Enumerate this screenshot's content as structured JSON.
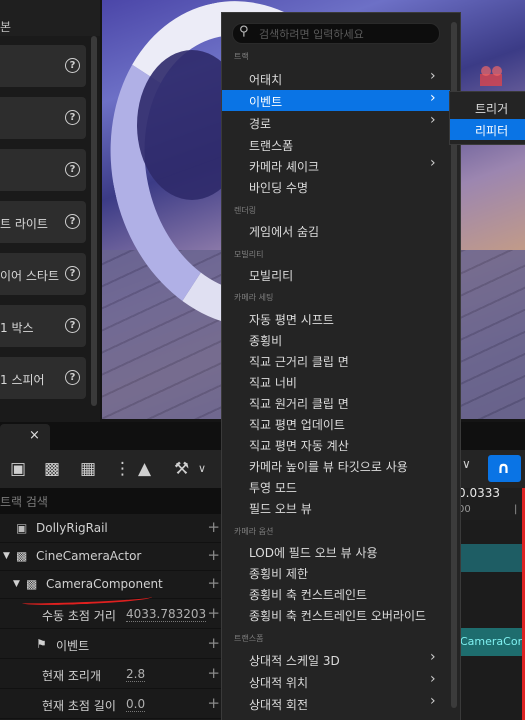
{
  "left_panel": {
    "header": "본",
    "items": [
      "",
      "",
      "",
      "트 라이트",
      "이어 스타트",
      "1 박스",
      "1 스피어"
    ]
  },
  "sequencer": {
    "tab_close": "×",
    "search_placeholder": "트랙 검색",
    "time_display": "0.0333",
    "time_tick": "00",
    "tracks": [
      {
        "label": "DollyRigRail"
      },
      {
        "label": "CineCameraActor"
      },
      {
        "label": "CameraComponent"
      },
      {
        "label": "수동 초점 거리",
        "value": "4033.783203"
      },
      {
        "label": "이벤트"
      },
      {
        "label": "현재 조리개",
        "value": "2.8"
      },
      {
        "label": "현재 초점 길이",
        "value": "0.0"
      }
    ],
    "track_clip_label": "CameraComp"
  },
  "context_menu": {
    "search_placeholder": "검색하려면 입력하세요",
    "sections": {
      "track": "트랙",
      "rendering": "렌더링",
      "mobility": "모빌리티",
      "camera_settings": "카메라 세팅",
      "camera_options": "카메라 옵션",
      "transform": "트랜스폼"
    },
    "items": {
      "attach": "어태치",
      "event": "이벤트",
      "path": "경로",
      "transform": "트랜스폼",
      "camera_shake": "카메라 셰이크",
      "binding_lifetime": "바인딩 수명",
      "hide_in_game": "게임에서 숨김",
      "mobility": "모빌리티",
      "auto_plane_shift": "자동 평면 시프트",
      "aspect_ratio": "종횡비",
      "ortho_near_clip": "직교 근거리 클립 면",
      "ortho_width": "직교 너비",
      "ortho_far_clip": "직교 원거리 클립 면",
      "ortho_plane_update": "직교 평면 업데이트",
      "ortho_plane_auto_calc": "직교 평면 자동 계산",
      "use_camera_height_as_view_target": "카메라 높이를 뷰 타깃으로 사용",
      "projection_mode": "투영 모드",
      "field_of_view": "필드 오브 뷰",
      "use_lod_fov": "LOD에 필드 오브 뷰 사용",
      "constrain_aspect_ratio": "종횡비 제한",
      "aspect_ratio_axis_constraint": "종횡비 축 컨스트레인트",
      "override_aspect_ratio_axis_constraint": "종횡비 축 컨스트레인트 오버라이드",
      "relative_scale_3d": "상대적 스케일 3D",
      "relative_location": "상대적 위치",
      "relative_rotation": "상대적 회전"
    }
  },
  "submenu": {
    "trigger": "트리거",
    "repeater": "리피터"
  },
  "colors": {
    "selection": "#0a74e5",
    "menu_bg": "#242424",
    "annotation_red": "#e0201f"
  }
}
